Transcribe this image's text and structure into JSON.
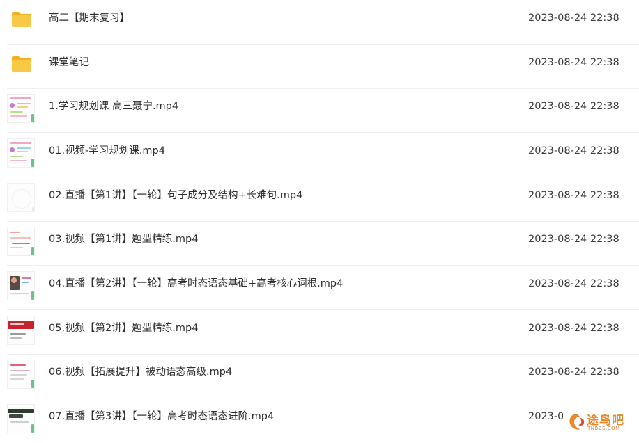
{
  "files": [
    {
      "type": "folder",
      "name": "高二【期末复习】",
      "modified": "2023-08-24 22:38",
      "thumb": "folder-icon"
    },
    {
      "type": "folder",
      "name": "课堂笔记",
      "modified": "2023-08-24 22:38",
      "thumb": "folder-icon"
    },
    {
      "type": "video",
      "name": "1.学习规划课 高三聂宁.mp4",
      "modified": "2023-08-24 22:38",
      "thumb": "slide-thumbnail"
    },
    {
      "type": "video",
      "name": "01.视频-学习规划课.mp4",
      "modified": "2023-08-24 22:38",
      "thumb": "slide-thumbnail"
    },
    {
      "type": "video",
      "name": "02.直播【第1讲】【一轮】句子成分及结构+长难句.mp4",
      "modified": "2023-08-24 22:38",
      "thumb": "blank-thumbnail"
    },
    {
      "type": "video",
      "name": "03.视频【第1讲】题型精练.mp4",
      "modified": "2023-08-24 22:38",
      "thumb": "slide-thumbnail"
    },
    {
      "type": "video",
      "name": "04.直播【第2讲】【一轮】高考时态语态基础+高考核心词根.mp4",
      "modified": "2023-08-24 22:38",
      "thumb": "photo-thumbnail"
    },
    {
      "type": "video",
      "name": "05.视频【第2讲】题型精练.mp4",
      "modified": "2023-08-24 22:38",
      "thumb": "red-banner-thumbnail"
    },
    {
      "type": "video",
      "name": "06.视频【拓展提升】被动语态高级.mp4",
      "modified": "2023-08-24 22:38",
      "thumb": "slide-thumbnail"
    },
    {
      "type": "video",
      "name": "07.直播【第3讲】【一轮】高考时态语态进阶.mp4",
      "modified": "2023-0",
      "thumb": "dark-header-thumbnail"
    }
  ],
  "watermark": {
    "text": "途鸟吧",
    "sub": "TNBZS.COM"
  },
  "colors": {
    "folder": "#f7c23a",
    "folder_tab": "#f2b11f",
    "separator": "#eeeff1",
    "watermark": "#e8892b"
  }
}
